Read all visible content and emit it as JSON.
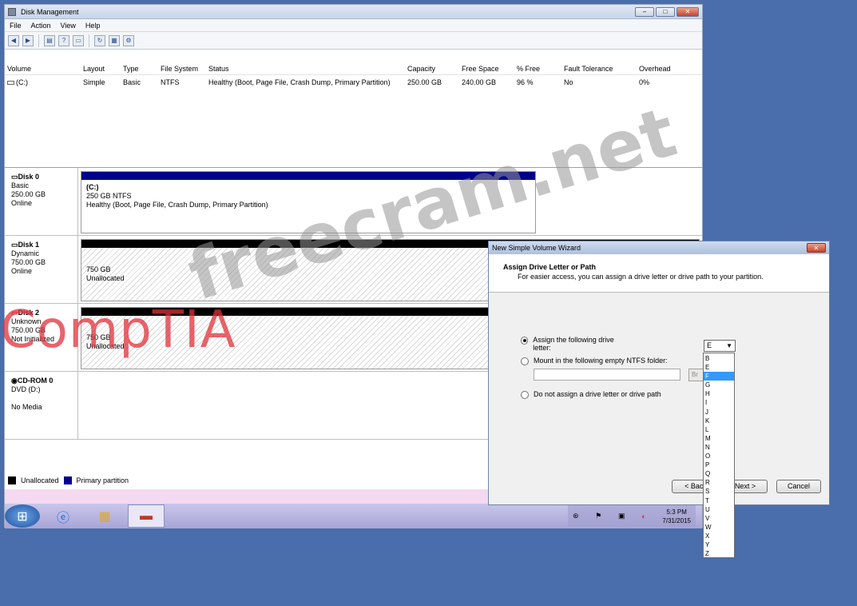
{
  "window": {
    "title": "Disk Management",
    "min": "–",
    "max": "□",
    "close": "✕"
  },
  "menu": [
    "File",
    "Action",
    "View",
    "Help"
  ],
  "toolbar_icons": [
    "back-icon",
    "forward-icon",
    "list-icon",
    "help-icon",
    "properties-icon",
    "refresh-icon",
    "rescan-icon",
    "settings-icon"
  ],
  "table": {
    "headers": [
      "Volume",
      "Layout",
      "Type",
      "File System",
      "Status",
      "Capacity",
      "Free Space",
      "% Free",
      "Fault Tolerance",
      "Overhead"
    ],
    "rows": [
      [
        "(C:)",
        "Simple",
        "Basic",
        "NTFS",
        "Healthy (Boot, Page File, Crash Dump, Primary Partition)",
        "250.00 GB",
        "240.00 GB",
        "96 %",
        "No",
        "0%"
      ]
    ]
  },
  "disks": [
    {
      "name": "Disk 0",
      "type": "Basic",
      "size": "250.00 GB",
      "state": "Online",
      "part_title": "(C:)",
      "part_size": "250 GB NTFS",
      "part_status": "Healthy (Boot, Page File, Crash Dump, Primary Partition)"
    },
    {
      "name": "Disk 1",
      "type": "Dynamic",
      "size": "750.00 GB",
      "state": "Online",
      "part_size": "750 GB",
      "part_status": "Unallocated"
    },
    {
      "name": "Disk 2",
      "type": "Unknown",
      "size": "750.00 GB",
      "state": "Not Initialized",
      "part_size": "750 GB",
      "part_status": "Unallocated"
    },
    {
      "name": "CD-ROM 0",
      "type": "DVD (D:)",
      "state": "No Media"
    }
  ],
  "legend": {
    "unallocated": "Unallocated",
    "primary": "Primary partition",
    "unallocated_color": "#000000",
    "primary_color": "#00008b"
  },
  "taskbar": {
    "time": "5:3 PM",
    "date": "7/31/2015"
  },
  "wizard": {
    "title": "New Simple Volume Wizard",
    "close": "✕",
    "heading": "Assign Drive Letter or Path",
    "subheading": "For easier access, you can assign a drive letter or drive path to your partition.",
    "opt1": "Assign the following drive letter:",
    "opt2": "Mount in the following empty NTFS folder:",
    "opt3": "Do not assign a drive letter or drive path",
    "browse": "Br",
    "selected_letter": "E",
    "back": "< Back",
    "next": "Next >",
    "cancel": "Cancel"
  },
  "drive_letters": [
    "B",
    "E",
    "F",
    "G",
    "H",
    "I",
    "J",
    "K",
    "L",
    "M",
    "N",
    "O",
    "P",
    "Q",
    "R",
    "S",
    "T",
    "U",
    "V",
    "W",
    "X",
    "Y",
    "Z"
  ],
  "highlighted_letter": "F",
  "watermarks": {
    "comptia": "CompTIA",
    "freecram": "freecram.net",
    "comptia_color": "#e0303a"
  }
}
